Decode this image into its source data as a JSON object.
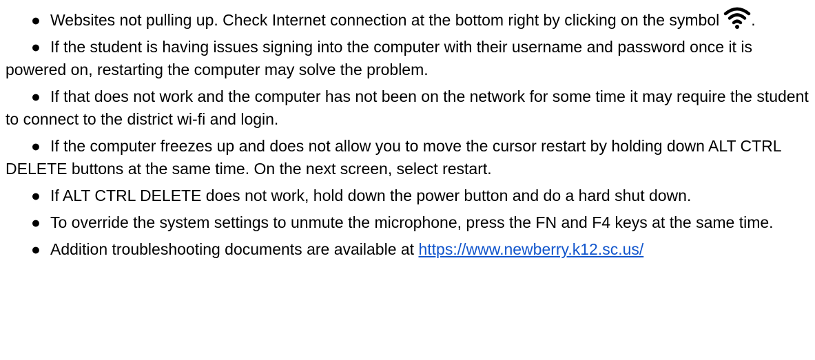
{
  "bullet_glyph": "●",
  "items": [
    {
      "text_before": "Websites not pulling up. Check Internet connection at the bottom right by clicking on the symbol",
      "text_after": "."
    },
    {
      "text": "If the student is having issues signing into the computer with their username and password once it is powered on, restarting the computer may solve the problem."
    },
    {
      "text": "If that does not work and the computer has not been on the network for some time it may require the student to connect to the district wi-fi and login."
    },
    {
      "text": "If the computer freezes up and does not allow you to move the cursor restart by holding down ALT CTRL DELETE buttons at the same time. On the next screen, select restart."
    },
    {
      "text": "If ALT CTRL DELETE does not work, hold down the power button and do a hard shut down."
    },
    {
      "text": "To override the system settings to unmute the microphone, press the FN and F4 keys at the same time."
    },
    {
      "text": "Addition troubleshooting documents are available at",
      "link": "https://www.newberry.k12.sc.us/"
    }
  ],
  "icons": {
    "wifi": "wifi-icon"
  },
  "colors": {
    "text": "#000000",
    "link": "#1155cc",
    "background": "#ffffff"
  }
}
